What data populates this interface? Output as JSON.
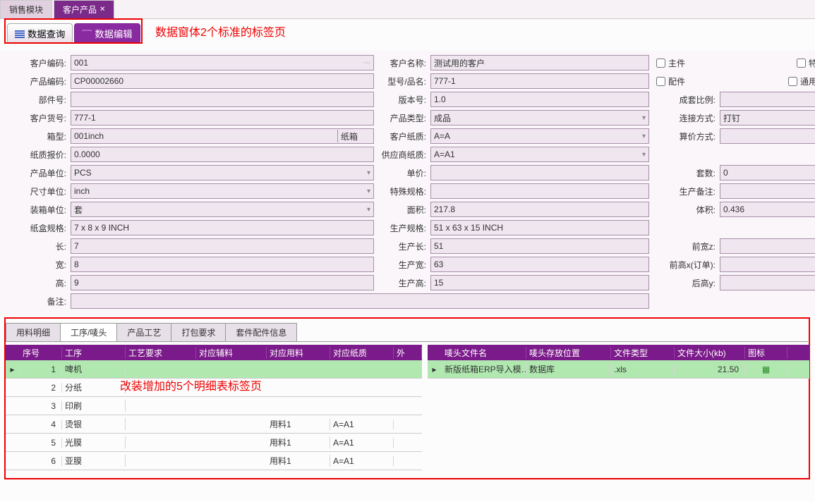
{
  "topTabs": {
    "sales": "销售模块",
    "customerProduct": "客户产品"
  },
  "toolbar": {
    "query": "数据查询",
    "edit": "数据编辑"
  },
  "annotations": {
    "top": "数据窗体2个标准的标签页",
    "bottom": "改装增加的5个明细表标签页"
  },
  "labels": {
    "custCode": "客户编码:",
    "custName": "客户名称:",
    "main": "主件",
    "special": "特价",
    "prodCode": "产品编码:",
    "model": "型号/品名:",
    "accessory": "配件",
    "universalBox": "通用箱",
    "partNo": "部件号:",
    "version": "版本号:",
    "setRatio": "成套比例:",
    "custArticle": "客户货号:",
    "prodType": "产品类型:",
    "connMethod": "连接方式:",
    "boxType": "箱型:",
    "custPaper": "客户纸质:",
    "calcMethod": "算价方式:",
    "paperPrice": "纸质报价:",
    "supplierPaper": "供应商纸质:",
    "prodUnit": "产品单位:",
    "unitPrice": "单价:",
    "sets": "套数:",
    "sizeUnit": "尺寸单位:",
    "specialSpec": "特殊规格:",
    "prodRemark": "生产备注:",
    "packUnit": "装箱单位:",
    "area": "面积:",
    "volume": "体积:",
    "boxSpec": "纸盒规格:",
    "produceSpec": "生产规格:",
    "length": "长:",
    "prodLen": "生产长:",
    "frontWidthZ": "前宽z:",
    "width": "宽:",
    "prodWid": "生产宽:",
    "frontHeightX": "前高x(订单):",
    "height": "高:",
    "prodHei": "生产高:",
    "backHeightY": "后高y:",
    "remark": "备注:"
  },
  "values": {
    "custCode": "001",
    "custName": "测试用的客户",
    "prodCode": "CP00002660",
    "model": "777-1",
    "partNo": "",
    "version": "1.0",
    "setRatio": "",
    "custArticle": "777-1",
    "prodType": "成品",
    "connMethod": "打钉",
    "boxType1": "001inch",
    "boxType2": "纸箱",
    "custPaper": "A=A",
    "calcMethod": "",
    "paperPrice": "0.0000",
    "supplierPaper": "A=A1",
    "prodUnit": "PCS",
    "unitPrice": "",
    "sets": "0",
    "sizeUnit": "inch",
    "specialSpec": "",
    "prodRemark": "",
    "packUnit": "套",
    "area": "217.8",
    "volume": "0.436",
    "boxSpec": "7 x 8 x 9 INCH",
    "produceSpec": "51 x 63 x 15 INCH",
    "length": "7",
    "prodLen": "51",
    "frontWidthZ": "",
    "width": "8",
    "prodWid": "63",
    "frontHeightX": "",
    "height": "9",
    "prodHei": "15",
    "backHeightY": "",
    "remark": ""
  },
  "detailTabs": {
    "material": "用料明细",
    "process": "工序/唛头",
    "tech": "产品工艺",
    "pack": "打包要求",
    "kit": "套件配件信息"
  },
  "grid1": {
    "headers": {
      "seq": "序号",
      "proc": "工序",
      "techReq": "工艺要求",
      "aux": "对应辅料",
      "mat": "对应用料",
      "paper": "对应纸质",
      "ext": "外"
    },
    "rows": [
      {
        "seq": "1",
        "proc": "啤机",
        "mat": "",
        "paper": ""
      },
      {
        "seq": "2",
        "proc": "分纸",
        "mat": "",
        "paper": ""
      },
      {
        "seq": "3",
        "proc": "印刷",
        "mat": "",
        "paper": ""
      },
      {
        "seq": "4",
        "proc": "烫银",
        "mat": "用料1",
        "paper": "A=A1"
      },
      {
        "seq": "5",
        "proc": "光膜",
        "mat": "用料1",
        "paper": "A=A1"
      },
      {
        "seq": "6",
        "proc": "亚膜",
        "mat": "用料1",
        "paper": "A=A1"
      }
    ]
  },
  "grid2": {
    "headers": {
      "fname": "唛头文件名",
      "loc": "唛头存放位置",
      "ftype": "文件类型",
      "fsize": "文件大小(kb)",
      "icon": "图标"
    },
    "rows": [
      {
        "fname": "新版纸箱ERP导入模…",
        "loc": "数据库",
        "ftype": ".xls",
        "fsize": "21.50"
      }
    ]
  }
}
